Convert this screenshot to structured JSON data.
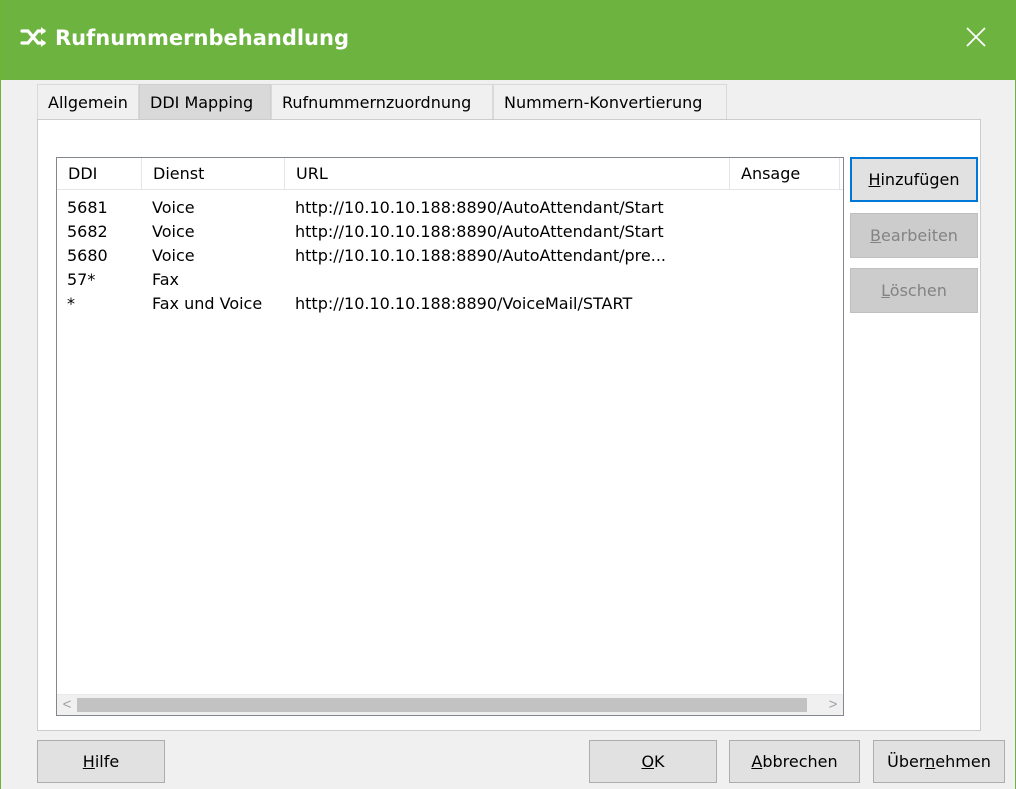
{
  "window": {
    "title": "Rufnummernbehandlung",
    "close_icon": "close-icon",
    "app_icon": "shuffle-arrows-icon",
    "title_color": "#6db33f"
  },
  "tabs": [
    {
      "label": "Allgemein",
      "active": false
    },
    {
      "label": "DDI Mapping",
      "active": true
    },
    {
      "label": "Rufnummernzuordnung",
      "active": false
    },
    {
      "label": "Nummern-Konvertierung",
      "active": false
    }
  ],
  "list": {
    "columns": [
      "DDI",
      "Dienst",
      "URL",
      "Ansage"
    ],
    "rows": [
      {
        "ddi": "5681",
        "dienst": "Voice",
        "url": "http://10.10.10.188:8890/AutoAttendant/Start",
        "ansage": ""
      },
      {
        "ddi": "5682",
        "dienst": "Voice",
        "url": "http://10.10.10.188:8890/AutoAttendant/Start",
        "ansage": ""
      },
      {
        "ddi": "5680",
        "dienst": "Voice",
        "url": "http://10.10.10.188:8890/AutoAttendant/pre...",
        "ansage": ""
      },
      {
        "ddi": "57*",
        "dienst": "Fax",
        "url": "",
        "ansage": ""
      },
      {
        "ddi": "*",
        "dienst": "Fax und Voice",
        "url": "http://10.10.10.188:8890/VoiceMail/START",
        "ansage": ""
      }
    ],
    "scroll_left_arrow": "<",
    "scroll_right_arrow": ">"
  },
  "side_buttons": {
    "add": {
      "mnemonic": "H",
      "rest": "inzufügen"
    },
    "edit": {
      "mnemonic": "B",
      "rest": "earbeiten"
    },
    "delete": {
      "mnemonic": "L",
      "rest": "öschen"
    }
  },
  "footer": {
    "help": {
      "mnemonic": "H",
      "rest": "ilfe"
    },
    "ok": {
      "mnemonic": "O",
      "rest": "K"
    },
    "cancel": {
      "mnemonic": "A",
      "rest": "bbrechen"
    },
    "apply": {
      "before": "Über",
      "mnemonic": "n",
      "rest": "ehmen"
    }
  }
}
